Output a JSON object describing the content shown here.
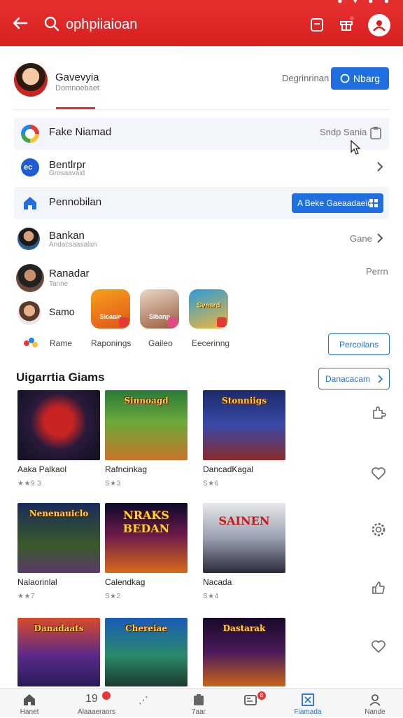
{
  "colors": {
    "header": "#d91f1f",
    "accent": "#1f6fe0",
    "shaded_row": "#f2f6fb"
  },
  "header": {
    "search_query": "ophpiiaioan",
    "icons": [
      "back-arrow-icon",
      "search-icon",
      "calendar-icon",
      "gift-icon",
      "account-icon"
    ]
  },
  "profile": {
    "name": "Gavevyia",
    "subtitle": "Domnoebaet",
    "secondary_action": "Degrinrinan",
    "primary_action": "Nbarg"
  },
  "rows": [
    {
      "label": "Fake Niamad",
      "right": "Sndp Sania"
    },
    {
      "label": "Bentlrpr",
      "subtitle": "Grosaavaid"
    },
    {
      "label": "Pennobilan",
      "button": "A Beke Gaeaadaein"
    },
    {
      "label": "Bankan",
      "subtitle": "Andacsaasalan",
      "right": "Gane"
    },
    {
      "label": "Ranadar",
      "subtitle": "Tanne",
      "right": "Perrn"
    }
  ],
  "apps_row": {
    "label": "Samo",
    "tiles": [
      "Sicaaie",
      "Sibanp",
      "Svasrd"
    ],
    "categories": [
      "Rame",
      "Raponings",
      "Gaileo",
      "Eecerinng"
    ],
    "action": "Percoilans"
  },
  "section": {
    "title": "Uigarrtia Giams",
    "action": "Danacacam"
  },
  "games": [
    {
      "name": "Aaka Palkaol",
      "rating": "★★9 3",
      "art_title": ""
    },
    {
      "name": "Rafncinkag",
      "rating": "S★3",
      "art_title": "Sinnoagd"
    },
    {
      "name": "DancadKagal",
      "rating": "S★6",
      "art_title": "Stonniigs"
    },
    {
      "name": "Nalaorinlal",
      "rating": "★★7",
      "art_title": "Nenenauiclo"
    },
    {
      "name": "Calendkag",
      "rating": "S★2",
      "art_title": "NRAKS BEDAN"
    },
    {
      "name": "Nacada",
      "rating": "S★4",
      "art_title": "SAINEN"
    },
    {
      "name": "",
      "rating": "",
      "art_title": "Danadaats"
    },
    {
      "name": "",
      "rating": "",
      "art_title": "Chereiae"
    },
    {
      "name": "",
      "rating": "",
      "art_title": "Dastarak"
    }
  ],
  "side_icons": [
    "puzzle-icon",
    "heart-icon",
    "settings-icon",
    "thumb-icon",
    "heart-outline-icon"
  ],
  "bottom_nav": [
    {
      "label": "Hanet",
      "icon": "home-icon"
    },
    {
      "label": "Alaaaeraors",
      "icon": "bell-icon",
      "badge": "19"
    },
    {
      "label": "",
      "icon": "dots-icon"
    },
    {
      "label": "7aar",
      "icon": "store-icon"
    },
    {
      "label": "",
      "icon": "library-icon",
      "badge": "8"
    },
    {
      "label": "Fiamada",
      "icon": "grid-icon",
      "active": true
    },
    {
      "label": "Nande",
      "icon": "profile-icon"
    }
  ]
}
